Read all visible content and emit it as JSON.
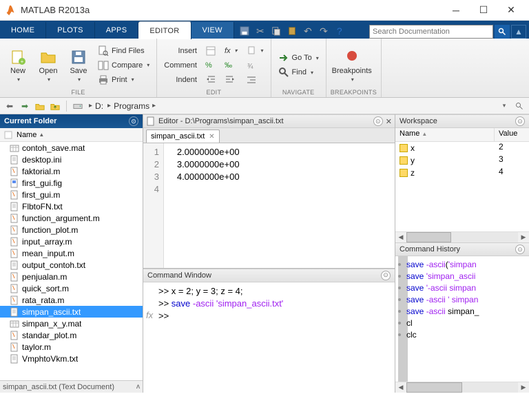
{
  "app_title": "MATLAB R2013a",
  "tabs": {
    "home": "HOME",
    "plots": "PLOTS",
    "apps": "APPS",
    "editor": "EDITOR",
    "view": "VIEW"
  },
  "search_placeholder": "Search Documentation",
  "ribbon": {
    "file": {
      "new": "New",
      "open": "Open",
      "save": "Save",
      "findfiles": "Find Files",
      "compare": "Compare",
      "print": "Print",
      "label": "FILE"
    },
    "edit": {
      "insert": "Insert",
      "comment": "Comment",
      "indent": "Indent",
      "fx": "fx",
      "label": "EDIT"
    },
    "nav": {
      "goto": "Go To",
      "find": "Find",
      "label": "NAVIGATE"
    },
    "bp": {
      "breakpoints": "Breakpoints",
      "label": "BREAKPOINTS"
    }
  },
  "breadcrumb": {
    "drive": "D:",
    "folder": "Programs"
  },
  "current_folder": {
    "title": "Current Folder",
    "namecol": "Name",
    "files": [
      {
        "n": "contoh_save.mat",
        "t": "mat"
      },
      {
        "n": "desktop.ini",
        "t": "ini"
      },
      {
        "n": "faktorial.m",
        "t": "m"
      },
      {
        "n": "first_gui.fig",
        "t": "fig"
      },
      {
        "n": "first_gui.m",
        "t": "m"
      },
      {
        "n": "FlbtoFN.txt",
        "t": "txt"
      },
      {
        "n": "function_argument.m",
        "t": "m"
      },
      {
        "n": "function_plot.m",
        "t": "m"
      },
      {
        "n": "input_array.m",
        "t": "m"
      },
      {
        "n": "mean_input.m",
        "t": "m"
      },
      {
        "n": "output_contoh.txt",
        "t": "txt"
      },
      {
        "n": "penjualan.m",
        "t": "m"
      },
      {
        "n": "quick_sort.m",
        "t": "m"
      },
      {
        "n": "rata_rata.m",
        "t": "m"
      },
      {
        "n": "simpan_ascii.txt",
        "t": "txt",
        "sel": true
      },
      {
        "n": "simpan_x_y.mat",
        "t": "mat"
      },
      {
        "n": "standar_plot.m",
        "t": "m"
      },
      {
        "n": "taylor.m",
        "t": "m"
      },
      {
        "n": "VmphtoVkm.txt",
        "t": "txt"
      }
    ],
    "status": "simpan_ascii.txt (Text Document)"
  },
  "editor_pane": {
    "title": "Editor - D:\\Programs\\simpan_ascii.txt",
    "tab": "simpan_ascii.txt",
    "lines": [
      "   2.0000000e+00",
      "   3.0000000e+00",
      "   4.0000000e+00",
      ""
    ]
  },
  "cmdwin": {
    "title": "Command Window",
    "lines": [
      {
        "p": ">> ",
        "t": "x = 2; y = 3; z = 4;"
      },
      {
        "p": ">> ",
        "cmd": "save ",
        "flag": "-ascii",
        "rest": " ",
        "str": "'simpan_ascii.txt'"
      },
      {
        "p": ">> ",
        "t": ""
      }
    ]
  },
  "workspace": {
    "title": "Workspace",
    "name": "Name",
    "value": "Value",
    "vars": [
      {
        "n": "x",
        "v": "2"
      },
      {
        "n": "y",
        "v": "3"
      },
      {
        "n": "z",
        "v": "4"
      }
    ]
  },
  "history": {
    "title": "Command History",
    "items": [
      "save -ascii('simpan",
      "save 'simpan_ascii",
      "save '-ascii simpan",
      "save -ascii ' simpan",
      "save -ascii simpan_",
      "cl",
      "clc"
    ]
  }
}
